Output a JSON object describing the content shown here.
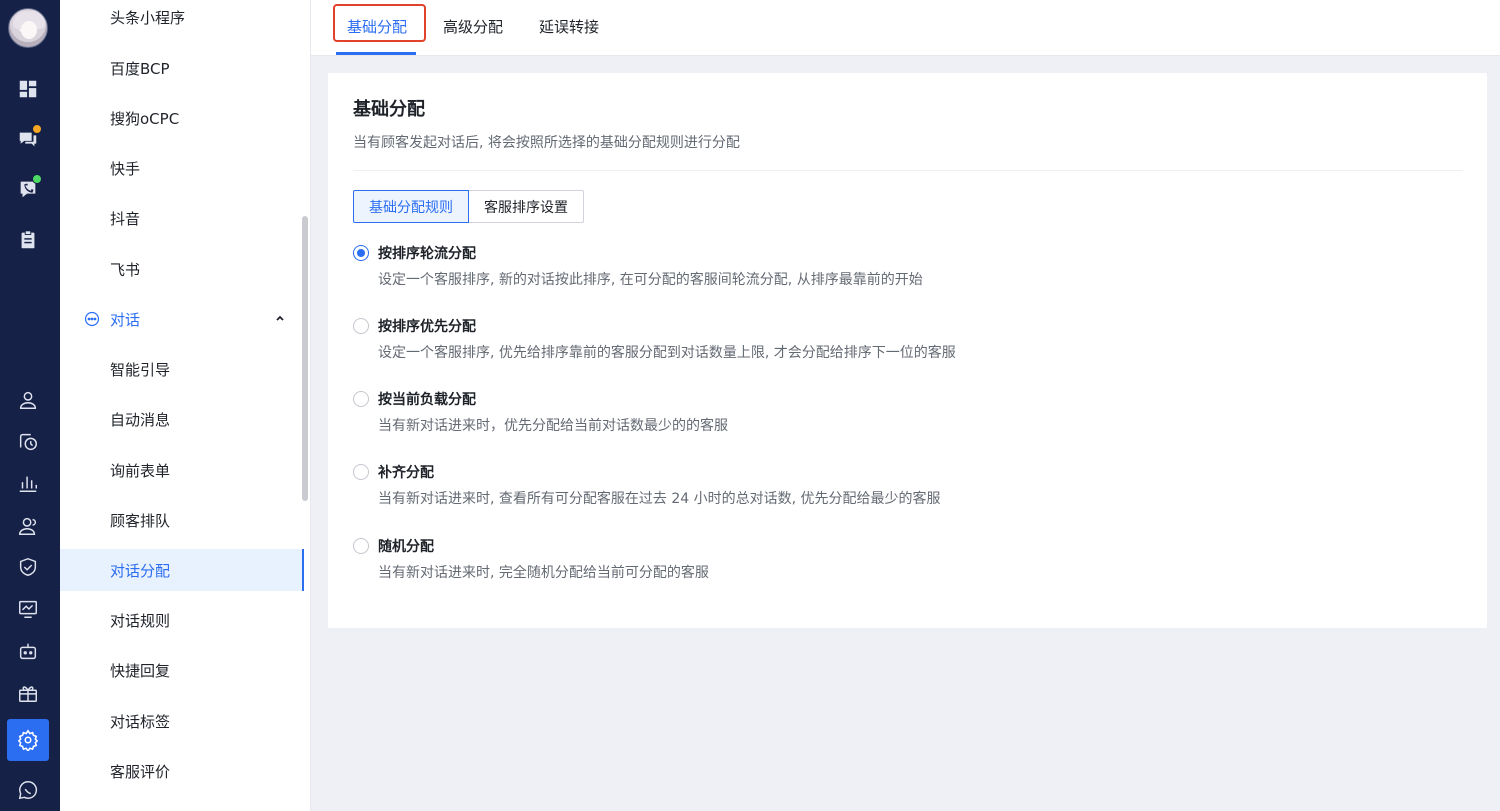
{
  "sidebar": {
    "items_top": [
      "头条小程序",
      "百度BCP",
      "搜狗oCPC",
      "快手",
      "抖音",
      "飞书"
    ],
    "group_label": "对话",
    "items_group": [
      "智能引导",
      "自动消息",
      "询前表单",
      "顾客排队",
      "对话分配",
      "对话规则",
      "快捷回复",
      "对话标签",
      "客服评价"
    ]
  },
  "tabs": [
    "基础分配",
    "高级分配",
    "延误转接"
  ],
  "card": {
    "title": "基础分配",
    "description": "当有顾客发起对话后, 将会按照所选择的基础分配规则进行分配",
    "segments": [
      "基础分配规则",
      "客服排序设置"
    ],
    "options": [
      {
        "label": "按排序轮流分配",
        "desc": "设定一个客服排序, 新的对话按此排序, 在可分配的客服间轮流分配, 从排序最靠前的开始",
        "checked": true
      },
      {
        "label": "按排序优先分配",
        "desc": "设定一个客服排序, 优先给排序靠前的客服分配到对话数量上限, 才会分配给排序下一位的客服",
        "checked": false
      },
      {
        "label": "按当前负载分配",
        "desc": "当有新对话进来时，优先分配给当前对话数最少的的客服",
        "checked": false
      },
      {
        "label": "补齐分配",
        "desc": "当有新对话进来时, 查看所有可分配客服在过去 24 小时的总对话数, 优先分配给最少的客服",
        "checked": false
      },
      {
        "label": "随机分配",
        "desc": "当有新对话进来时, 完全随机分配给当前可分配的客服",
        "checked": false
      }
    ]
  },
  "colors": {
    "accent": "#2c6ef2",
    "rail": "#152146",
    "badge_orange": "#f5a623",
    "badge_green": "#4cd964",
    "highlight_red": "#e2412c"
  },
  "rail_icons": [
    "dashboard-icon",
    "chat-icon",
    "phone-icon",
    "clipboard-icon",
    "user-icon",
    "history-icon",
    "bar-chart-icon",
    "users-icon",
    "shield-icon",
    "monitor-icon",
    "robot-icon",
    "gift-icon",
    "settings-icon",
    "message-icon"
  ]
}
